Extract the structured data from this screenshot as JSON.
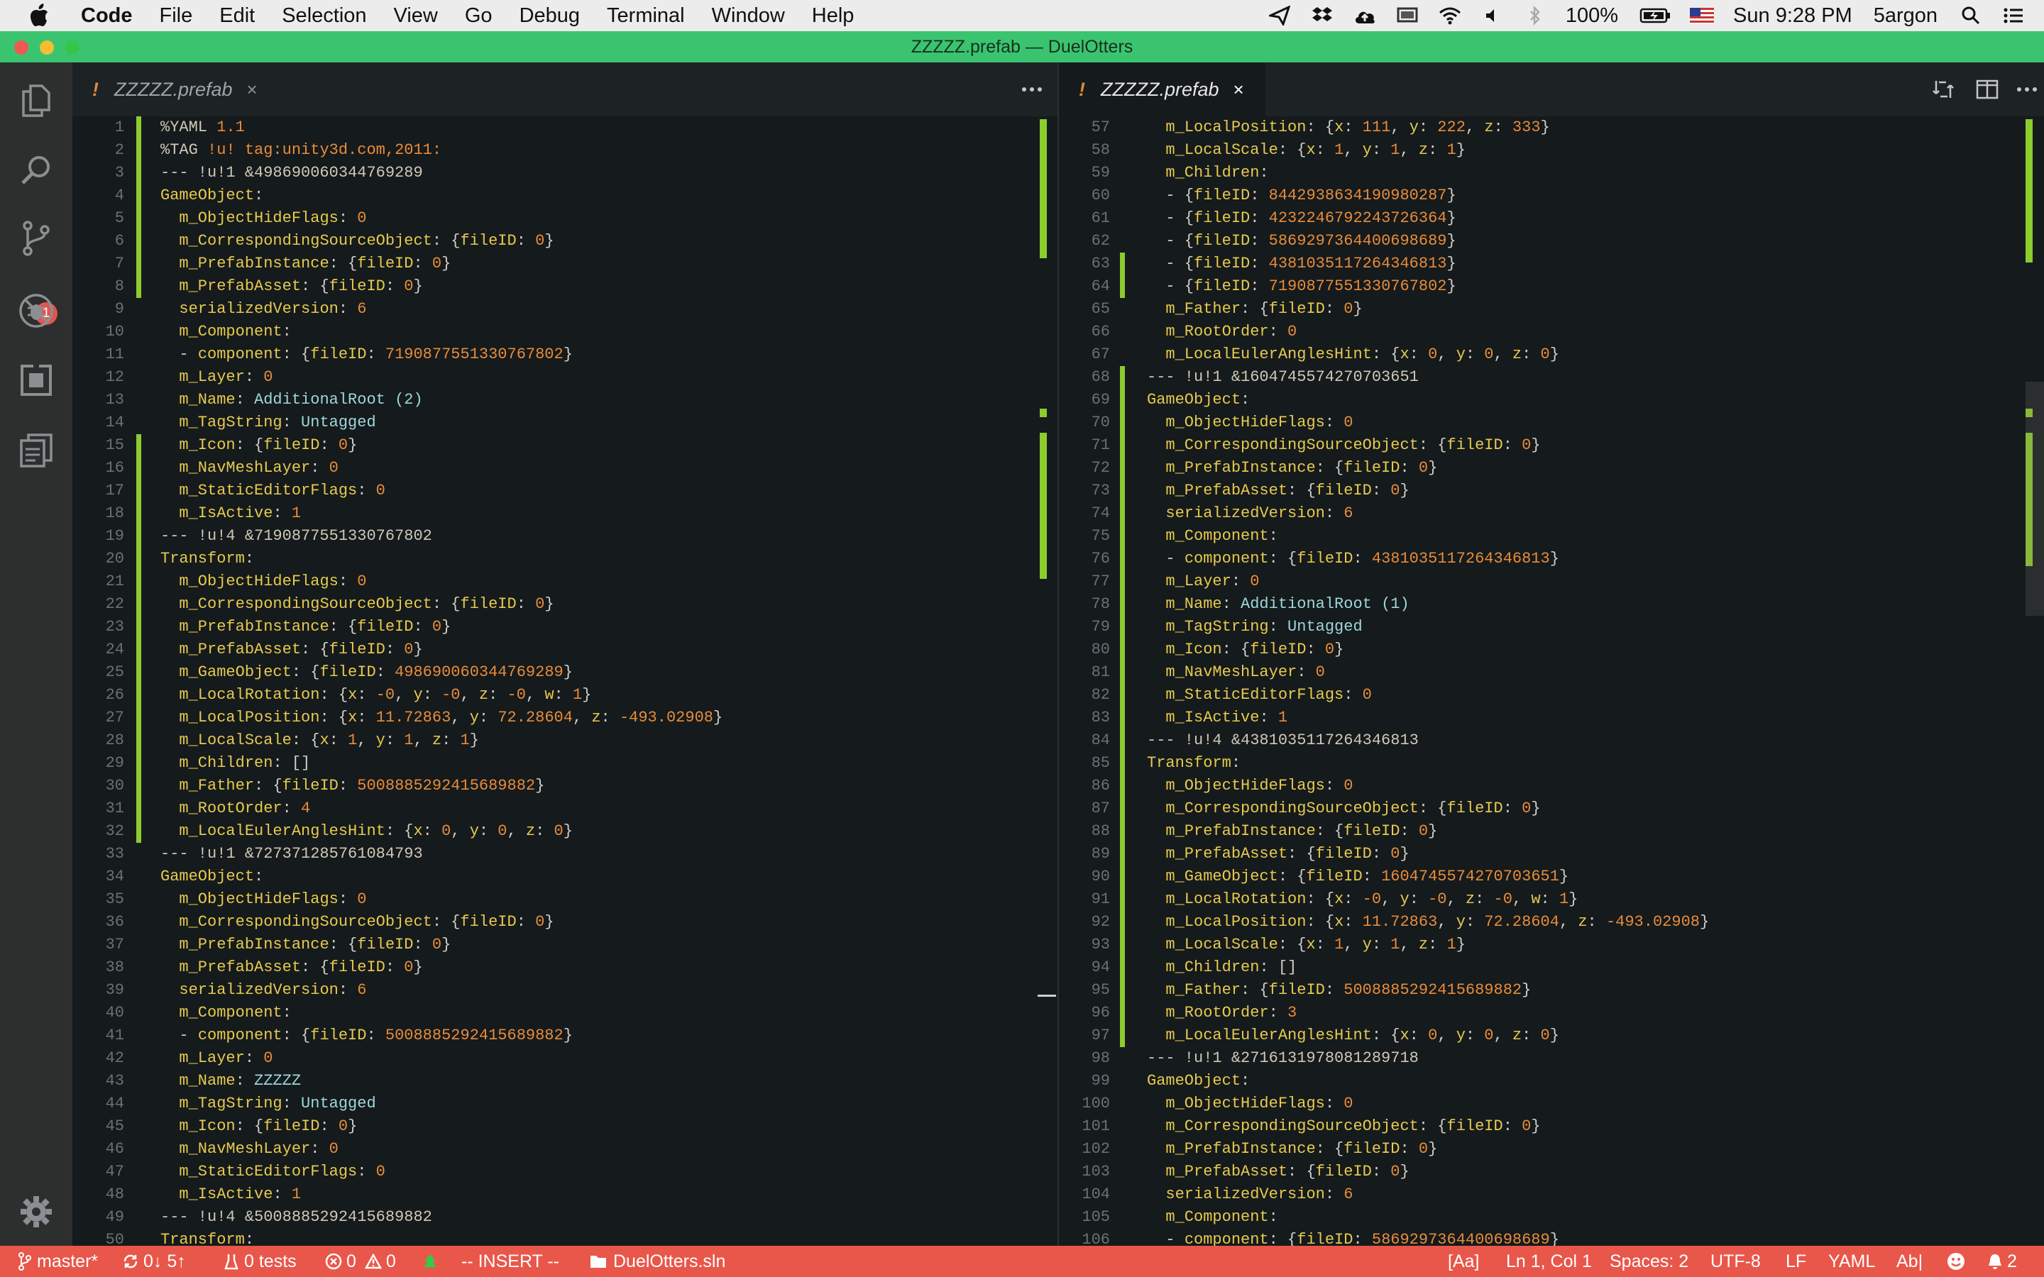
{
  "menubar": {
    "items": [
      "Code",
      "File",
      "Edit",
      "Selection",
      "View",
      "Go",
      "Debug",
      "Terminal",
      "Window",
      "Help"
    ],
    "battery": "100%",
    "clock": "Sun 9:28 PM",
    "user": "5argon"
  },
  "window": {
    "title": "ZZZZZ.prefab — DuelOtters"
  },
  "activity_bar": {
    "scm_badge": "1"
  },
  "left_editor": {
    "tab": {
      "modified_marker": "!",
      "filename": "ZZZZZ.prefab",
      "close_glyph": "×"
    },
    "more_glyph": "···"
  },
  "right_editor": {
    "tab": {
      "modified_marker": "!",
      "filename": "ZZZZZ.prefab",
      "close_glyph": "×"
    },
    "more_glyph": "···"
  },
  "status_bar": {
    "branch": "master*",
    "sync": "0↓ 5↑",
    "tests": "0 tests",
    "errors": "0",
    "warnings": "0",
    "mode": "-- INSERT --",
    "solution": "DuelOtters.sln",
    "match_case": "[Aa]",
    "position": "Ln 1, Col 1",
    "spaces": "Spaces: 2",
    "encoding": "UTF-8",
    "eol": "LF",
    "language": "YAML",
    "ab": "Ab|",
    "notifications": "2"
  },
  "colors": {
    "titlebar": "#3bc46f",
    "statusbar": "#e8574a",
    "gutter_change": "#8ccc2c"
  },
  "left_lines": [
    {
      "n": "1",
      "t": "%YAML 1.1"
    },
    {
      "n": "2",
      "t": "%TAG !u! tag:unity3d.com,2011:"
    },
    {
      "n": "3",
      "t": "--- !u!1 &4986900603447692​89"
    },
    {
      "n": "4",
      "t": "GameObject:"
    },
    {
      "n": "5",
      "t": "  m_ObjectHideFlags: 0"
    },
    {
      "n": "6",
      "t": "  m_CorrespondingSourceObject: {fileID: 0}"
    },
    {
      "n": "7",
      "t": "  m_PrefabInstance: {fileID: 0}"
    },
    {
      "n": "8",
      "t": "  m_PrefabAsset: {fileID: 0}"
    },
    {
      "n": "9",
      "t": "  serializedVersion: 6"
    },
    {
      "n": "10",
      "t": "  m_Component:"
    },
    {
      "n": "11",
      "t": "  - component: {fileID: 7190877551330767802}"
    },
    {
      "n": "12",
      "t": "  m_Layer: 0"
    },
    {
      "n": "13",
      "t": "  m_Name: AdditionalRoot (2)"
    },
    {
      "n": "14",
      "t": "  m_TagString: Untagged"
    },
    {
      "n": "15",
      "t": "  m_Icon: {fileID: 0}"
    },
    {
      "n": "16",
      "t": "  m_NavMeshLayer: 0"
    },
    {
      "n": "17",
      "t": "  m_StaticEditorFlags: 0"
    },
    {
      "n": "18",
      "t": "  m_IsActive: 1"
    },
    {
      "n": "19",
      "t": "--- !u!4 &7190877551330767802"
    },
    {
      "n": "20",
      "t": "Transform:"
    },
    {
      "n": "21",
      "t": "  m_ObjectHideFlags: 0"
    },
    {
      "n": "22",
      "t": "  m_CorrespondingSourceObject: {fileID: 0}"
    },
    {
      "n": "23",
      "t": "  m_PrefabInstance: {fileID: 0}"
    },
    {
      "n": "24",
      "t": "  m_PrefabAsset: {fileID: 0}"
    },
    {
      "n": "25",
      "t": "  m_GameObject: {fileID: 498690060344769289}"
    },
    {
      "n": "26",
      "t": "  m_LocalRotation: {x: -0, y: -0, z: -0, w: 1}"
    },
    {
      "n": "27",
      "t": "  m_LocalPosition: {x: 11.72863, y: 72.28604, z: -493.02908}"
    },
    {
      "n": "28",
      "t": "  m_LocalScale: {x: 1, y: 1, z: 1}"
    },
    {
      "n": "29",
      "t": "  m_Children: []"
    },
    {
      "n": "30",
      "t": "  m_Father: {fileID: 5008885292415689882}"
    },
    {
      "n": "31",
      "t": "  m_RootOrder: 4"
    },
    {
      "n": "32",
      "t": "  m_LocalEulerAnglesHint: {x: 0, y: 0, z: 0}"
    },
    {
      "n": "33",
      "t": "--- !u!1 &727371285761084793"
    },
    {
      "n": "34",
      "t": "GameObject:"
    },
    {
      "n": "35",
      "t": "  m_ObjectHideFlags: 0"
    },
    {
      "n": "36",
      "t": "  m_CorrespondingSourceObject: {fileID: 0}"
    },
    {
      "n": "37",
      "t": "  m_PrefabInstance: {fileID: 0}"
    },
    {
      "n": "38",
      "t": "  m_PrefabAsset: {fileID: 0}"
    },
    {
      "n": "39",
      "t": "  serializedVersion: 6"
    },
    {
      "n": "40",
      "t": "  m_Component:"
    },
    {
      "n": "41",
      "t": "  - component: {fileID: 5008885292415689882}"
    },
    {
      "n": "42",
      "t": "  m_Layer: 0"
    },
    {
      "n": "43",
      "t": "  m_Name: ZZZZZ"
    },
    {
      "n": "44",
      "t": "  m_TagString: Untagged"
    },
    {
      "n": "45",
      "t": "  m_Icon: {fileID: 0}"
    },
    {
      "n": "46",
      "t": "  m_NavMeshLayer: 0"
    },
    {
      "n": "47",
      "t": "  m_StaticEditorFlags: 0"
    },
    {
      "n": "48",
      "t": "  m_IsActive: 1"
    },
    {
      "n": "49",
      "t": "--- !u!4 &5008885292415689882"
    },
    {
      "n": "50",
      "t": "Transform:"
    }
  ],
  "right_lines": [
    {
      "n": "57",
      "t": "  m_LocalPosition: {x: 111, y: 222, z: 333}"
    },
    {
      "n": "58",
      "t": "  m_LocalScale: {x: 1, y: 1, z: 1}"
    },
    {
      "n": "59",
      "t": "  m_Children:"
    },
    {
      "n": "60",
      "t": "  - {fileID: 8442938634190980287}"
    },
    {
      "n": "61",
      "t": "  - {fileID: 4232246792243726364}"
    },
    {
      "n": "62",
      "t": "  - {fileID: 5869297364400698689}"
    },
    {
      "n": "63",
      "t": "  - {fileID: 4381035117264346813}"
    },
    {
      "n": "64",
      "t": "  - {fileID: 7190877551330767802}"
    },
    {
      "n": "65",
      "t": "  m_Father: {fileID: 0}"
    },
    {
      "n": "66",
      "t": "  m_RootOrder: 0"
    },
    {
      "n": "67",
      "t": "  m_LocalEulerAnglesHint: {x: 0, y: 0, z: 0}"
    },
    {
      "n": "68",
      "t": "--- !u!1 &1604745574270703651"
    },
    {
      "n": "69",
      "t": "GameObject:"
    },
    {
      "n": "70",
      "t": "  m_ObjectHideFlags: 0"
    },
    {
      "n": "71",
      "t": "  m_CorrespondingSourceObject: {fileID: 0}"
    },
    {
      "n": "72",
      "t": "  m_PrefabInstance: {fileID: 0}"
    },
    {
      "n": "73",
      "t": "  m_PrefabAsset: {fileID: 0}"
    },
    {
      "n": "74",
      "t": "  serializedVersion: 6"
    },
    {
      "n": "75",
      "t": "  m_Component:"
    },
    {
      "n": "76",
      "t": "  - component: {fileID: 4381035117264346813}"
    },
    {
      "n": "77",
      "t": "  m_Layer: 0"
    },
    {
      "n": "78",
      "t": "  m_Name: AdditionalRoot (1)"
    },
    {
      "n": "79",
      "t": "  m_TagString: Untagged"
    },
    {
      "n": "80",
      "t": "  m_Icon: {fileID: 0}"
    },
    {
      "n": "81",
      "t": "  m_NavMeshLayer: 0"
    },
    {
      "n": "82",
      "t": "  m_StaticEditorFlags: 0"
    },
    {
      "n": "83",
      "t": "  m_IsActive: 1"
    },
    {
      "n": "84",
      "t": "--- !u!4 &4381035117264346813"
    },
    {
      "n": "85",
      "t": "Transform:"
    },
    {
      "n": "86",
      "t": "  m_ObjectHideFlags: 0"
    },
    {
      "n": "87",
      "t": "  m_CorrespondingSourceObject: {fileID: 0}"
    },
    {
      "n": "88",
      "t": "  m_PrefabInstance: {fileID: 0}"
    },
    {
      "n": "89",
      "t": "  m_PrefabAsset: {fileID: 0}"
    },
    {
      "n": "90",
      "t": "  m_GameObject: {fileID: 1604745574270703651}"
    },
    {
      "n": "91",
      "t": "  m_LocalRotation: {x: -0, y: -0, z: -0, w: 1}"
    },
    {
      "n": "92",
      "t": "  m_LocalPosition: {x: 11.72863, y: 72.28604, z: -493.02908}"
    },
    {
      "n": "93",
      "t": "  m_LocalScale: {x: 1, y: 1, z: 1}"
    },
    {
      "n": "94",
      "t": "  m_Children: []"
    },
    {
      "n": "95",
      "t": "  m_Father: {fileID: 5008885292415689882}"
    },
    {
      "n": "96",
      "t": "  m_RootOrder: 3"
    },
    {
      "n": "97",
      "t": "  m_LocalEulerAnglesHint: {x: 0, y: 0, z: 0}"
    },
    {
      "n": "98",
      "t": "--- !u!1 &2716131978081289718"
    },
    {
      "n": "99",
      "t": "GameObject:"
    },
    {
      "n": "100",
      "t": "  m_ObjectHideFlags: 0"
    },
    {
      "n": "101",
      "t": "  m_CorrespondingSourceObject: {fileID: 0}"
    },
    {
      "n": "102",
      "t": "  m_PrefabInstance: {fileID: 0}"
    },
    {
      "n": "103",
      "t": "  m_PrefabAsset: {fileID: 0}"
    },
    {
      "n": "104",
      "t": "  serializedVersion: 6"
    },
    {
      "n": "105",
      "t": "  m_Component:"
    },
    {
      "n": "106",
      "t": "  - component: {fileID: 5869297364400698689}"
    }
  ],
  "left_changed_lines": [
    "1",
    "2",
    "3",
    "4",
    "5",
    "6",
    "7",
    "8",
    "15",
    "16",
    "17",
    "18",
    "19",
    "20",
    "21",
    "22",
    "23",
    "24",
    "25",
    "26",
    "27",
    "28",
    "29",
    "30",
    "31",
    "32"
  ],
  "right_changed_lines": [
    "63",
    "64",
    "68",
    "69",
    "70",
    "71",
    "72",
    "73",
    "74",
    "75",
    "76",
    "77",
    "78",
    "79",
    "80",
    "81",
    "82",
    "83",
    "84",
    "85",
    "86",
    "87",
    "88",
    "89",
    "90",
    "91",
    "92",
    "93",
    "94",
    "95",
    "96",
    "97"
  ]
}
